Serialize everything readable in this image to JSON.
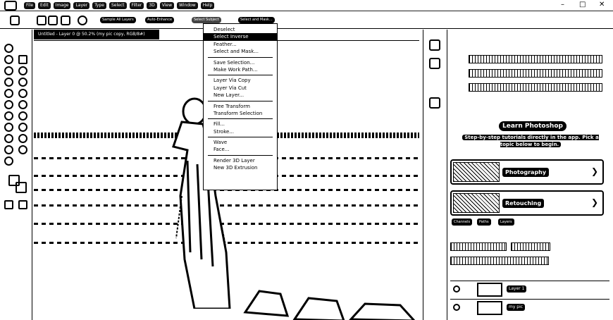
{
  "menubar": {
    "items": [
      "File",
      "Edit",
      "Image",
      "Layer",
      "Type",
      "Select",
      "Filter",
      "3D",
      "View",
      "Window",
      "Help"
    ],
    "window_controls": [
      "–",
      "□",
      "✕"
    ]
  },
  "options_bar": {
    "sample_all_layers": "Sample All Layers",
    "auto_enhance": "Auto-Enhance",
    "select_subject": "Select Subject",
    "select_and_mask": "Select and Mask..."
  },
  "document": {
    "tab_title": "Untitled - Layer 0 @ 50.2% (my pic copy, RGB/8#)"
  },
  "context_menu": {
    "groups": [
      [
        "Deselect",
        "Select Inverse",
        "Feather...",
        "Select and Mask..."
      ],
      [
        "Save Selection...",
        "Make Work Path..."
      ],
      [
        "Layer Via Copy",
        "Layer Via Cut",
        "New Layer..."
      ],
      [
        "Free Transform",
        "Transform Selection"
      ],
      [
        "Fill...",
        "Stroke..."
      ],
      [
        "Wave",
        "Face..."
      ],
      [
        "Render 3D Layer",
        "New 3D Extrusion"
      ]
    ],
    "active": "Select Inverse"
  },
  "learn_panel": {
    "title": "Learn Photoshop",
    "subtitle": "Step-by-step tutorials directly in the app. Pick a topic below to begin.",
    "cards": [
      "Photography",
      "Retouching"
    ]
  },
  "layers_panel": {
    "tabs": [
      "Channels",
      "Paths",
      "Layers"
    ],
    "layers": [
      "Layer 1",
      "my pic"
    ]
  },
  "icons": [
    "photoshop-logo-icon",
    "move-tool-icon",
    "lasso-tool-icon",
    "brush-tool-icon",
    "eye-icon",
    "chevron-right-icon"
  ]
}
